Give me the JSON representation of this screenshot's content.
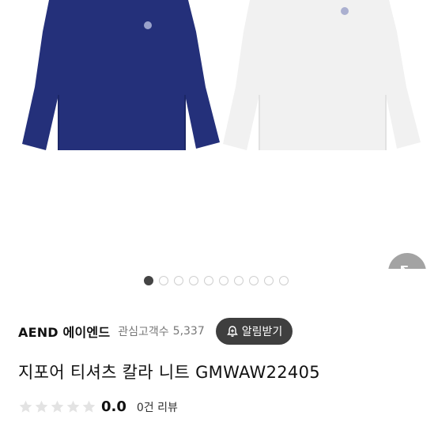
{
  "gallery": {
    "dot_count": 10,
    "active_index": 0,
    "expand_icon": "expand-arrows-icon",
    "colors": {
      "navy": "#24307a",
      "white": "#f1f1f1",
      "expand_bg": "#a3a3a3"
    }
  },
  "brand": {
    "name": "AEND 에이엔드",
    "interest_label": "관심고객수",
    "interest_count": "5,337",
    "alarm_label": "알림받기",
    "alarm_icon": "bell-plus-icon"
  },
  "product": {
    "title": "지포어 티셔츠 칼라 니트 GMWAW22405"
  },
  "rating": {
    "score": "0.0",
    "stars_filled": 0,
    "stars_total": 5,
    "review_count": "0건 리뷰"
  }
}
